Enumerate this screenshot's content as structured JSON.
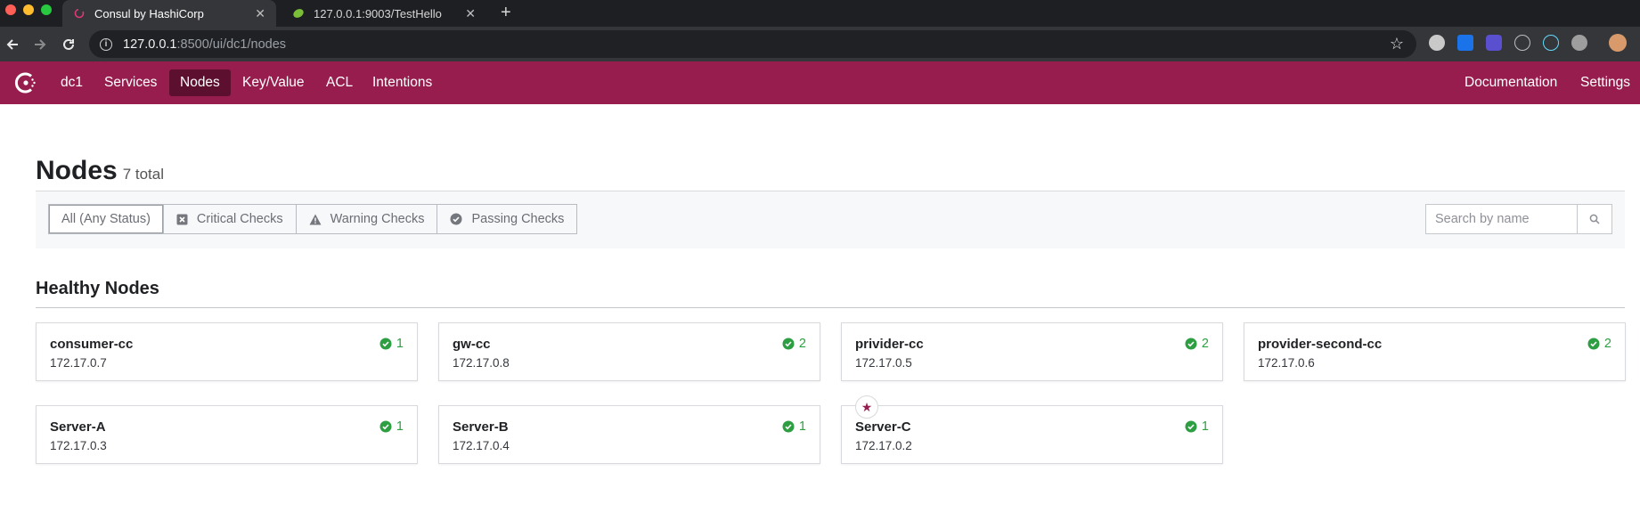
{
  "browser": {
    "tabs": [
      {
        "title": "Consul by HashiCorp",
        "active": true
      },
      {
        "title": "127.0.0.1:9003/TestHello",
        "active": false
      }
    ],
    "url_host": "127.0.0.1",
    "url_rest": ":8500/ui/dc1/nodes"
  },
  "header": {
    "datacenter": "dc1",
    "nav": [
      {
        "label": "Services",
        "active": false
      },
      {
        "label": "Nodes",
        "active": true
      },
      {
        "label": "Key/Value",
        "active": false
      },
      {
        "label": "ACL",
        "active": false
      },
      {
        "label": "Intentions",
        "active": false
      }
    ],
    "right_nav": [
      "Documentation",
      "Settings"
    ],
    "accent_color": "#961d4e"
  },
  "page": {
    "title": "Nodes",
    "total": "7 total"
  },
  "filters": {
    "options": [
      {
        "label": "All (Any Status)",
        "icon": "",
        "selected": true
      },
      {
        "label": "Critical Checks",
        "icon": "critical-x-icon",
        "selected": false
      },
      {
        "label": "Warning Checks",
        "icon": "warning-triangle-icon",
        "selected": false
      },
      {
        "label": "Passing Checks",
        "icon": "passing-check-icon",
        "selected": false
      }
    ],
    "search_placeholder": "Search by name"
  },
  "section": {
    "title": "Healthy Nodes"
  },
  "nodes": [
    {
      "name": "consumer-cc",
      "address": "172.17.0.7",
      "checks": "1",
      "leader": false
    },
    {
      "name": "gw-cc",
      "address": "172.17.0.8",
      "checks": "2",
      "leader": false
    },
    {
      "name": "privider-cc",
      "address": "172.17.0.5",
      "checks": "2",
      "leader": false
    },
    {
      "name": "provider-second-cc",
      "address": "172.17.0.6",
      "checks": "2",
      "leader": false
    },
    {
      "name": "Server-A",
      "address": "172.17.0.3",
      "checks": "1",
      "leader": false
    },
    {
      "name": "Server-B",
      "address": "172.17.0.4",
      "checks": "1",
      "leader": false
    },
    {
      "name": "Server-C",
      "address": "172.17.0.2",
      "checks": "1",
      "leader": true
    }
  ]
}
